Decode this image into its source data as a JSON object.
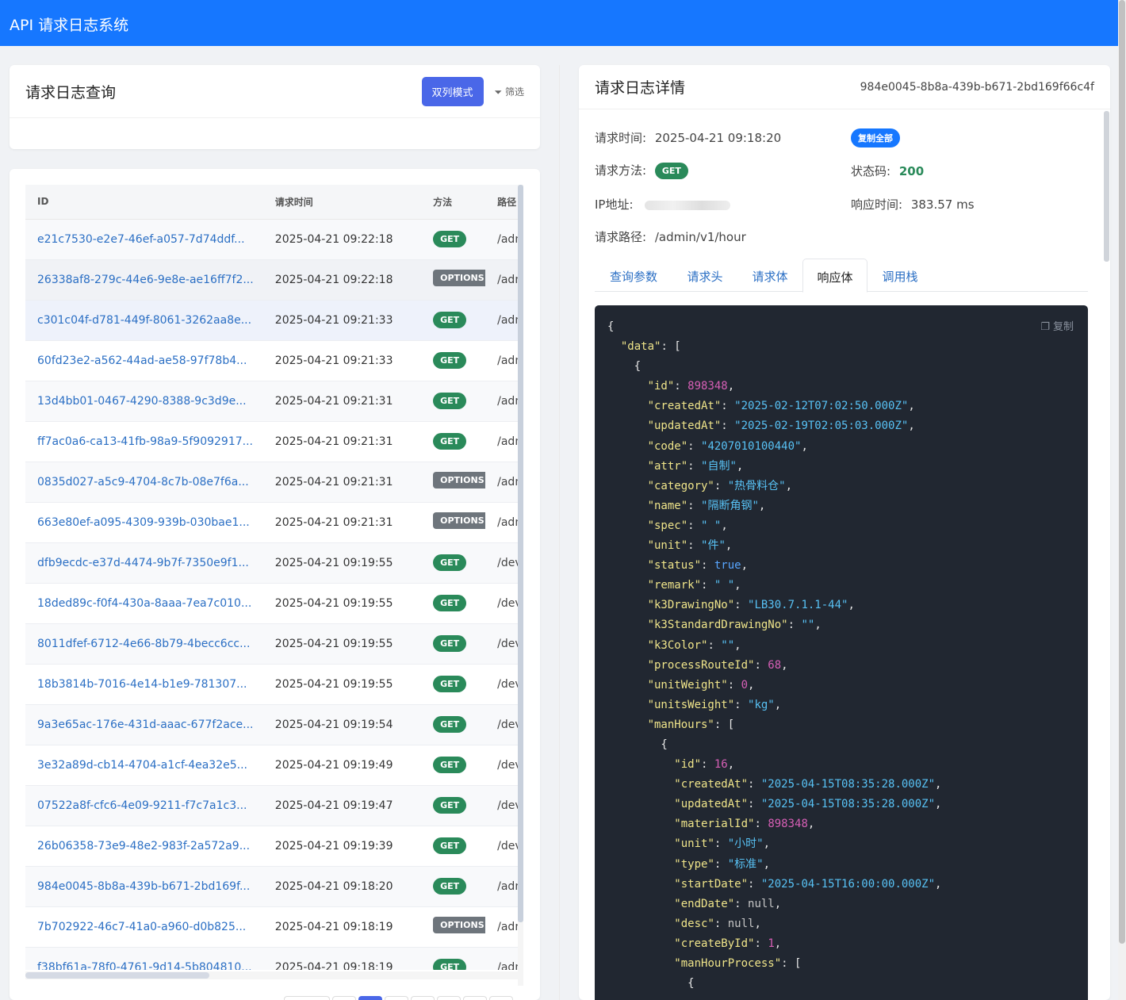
{
  "app": {
    "title": "API 请求日志系统"
  },
  "query": {
    "title": "请求日志查询",
    "dual_mode_label": "双列模式",
    "filter_label": "筛选"
  },
  "table": {
    "columns": [
      "ID",
      "请求时间",
      "方法",
      "路径"
    ],
    "rows": [
      {
        "id": "e21c7530-e2e7-46ef-a057-7d74ddf...",
        "time": "2025-04-21 09:22:18",
        "method": "GET",
        "path": "/adm"
      },
      {
        "id": "26338af8-279c-44e6-9e8e-ae16ff7f2...",
        "time": "2025-04-21 09:22:18",
        "method": "OPTIONS",
        "path": "/adm"
      },
      {
        "id": "c301c04f-d781-449f-8061-3262aa8e...",
        "time": "2025-04-21 09:21:33",
        "method": "GET",
        "path": "/adm"
      },
      {
        "id": "60fd23e2-a562-44ad-ae58-97f78b4...",
        "time": "2025-04-21 09:21:33",
        "method": "GET",
        "path": "/adm"
      },
      {
        "id": "13d4bb01-0467-4290-8388-9c3d9e...",
        "time": "2025-04-21 09:21:31",
        "method": "GET",
        "path": "/adm"
      },
      {
        "id": "ff7ac0a6-ca13-41fb-98a9-5f9092917...",
        "time": "2025-04-21 09:21:31",
        "method": "GET",
        "path": "/adm"
      },
      {
        "id": "0835d027-a5c9-4704-8c7b-08e7f6a...",
        "time": "2025-04-21 09:21:31",
        "method": "OPTIONS",
        "path": "/adm"
      },
      {
        "id": "663e80ef-a095-4309-939b-030bae1...",
        "time": "2025-04-21 09:21:31",
        "method": "OPTIONS",
        "path": "/adm"
      },
      {
        "id": "dfb9ecdc-e37d-4474-9b7f-7350e9f1...",
        "time": "2025-04-21 09:19:55",
        "method": "GET",
        "path": "/dev"
      },
      {
        "id": "18ded89c-f0f4-430a-8aaa-7ea7c010...",
        "time": "2025-04-21 09:19:55",
        "method": "GET",
        "path": "/dev"
      },
      {
        "id": "8011dfef-6712-4e66-8b79-4becc6cc...",
        "time": "2025-04-21 09:19:55",
        "method": "GET",
        "path": "/dev"
      },
      {
        "id": "18b3814b-7016-4e14-b1e9-781307...",
        "time": "2025-04-21 09:19:55",
        "method": "GET",
        "path": "/dev"
      },
      {
        "id": "9a3e65ac-176e-431d-aaac-677f2ace...",
        "time": "2025-04-21 09:19:54",
        "method": "GET",
        "path": "/dev"
      },
      {
        "id": "3e32a89d-cb14-4704-a1cf-4ea32e5...",
        "time": "2025-04-21 09:19:49",
        "method": "GET",
        "path": "/dev"
      },
      {
        "id": "07522a8f-cfc6-4e09-9211-f7c7a1c3...",
        "time": "2025-04-21 09:19:47",
        "method": "GET",
        "path": "/dev"
      },
      {
        "id": "26b06358-73e9-48e2-983f-2a572a9...",
        "time": "2025-04-21 09:19:39",
        "method": "GET",
        "path": "/dev"
      },
      {
        "id": "984e0045-8b8a-439b-b671-2bd169f...",
        "time": "2025-04-21 09:18:20",
        "method": "GET",
        "path": "/adm"
      },
      {
        "id": "7b702922-46c7-41a0-a960-d0b825...",
        "time": "2025-04-21 09:18:19",
        "method": "OPTIONS",
        "path": "/adm"
      },
      {
        "id": "f38bf61a-78f0-4761-9d14-5b804810...",
        "time": "2025-04-21 09:18:19",
        "method": "GET",
        "path": "/adm"
      }
    ]
  },
  "detail": {
    "title": "请求日志详情",
    "request_id": "984e0045-8b8a-439b-b671-2bd169f66c4f",
    "time_label": "请求时间:",
    "time_value": "2025-04-21 09:18:20",
    "copy_all_label": "复制全部",
    "method_label": "请求方法:",
    "method_value": "GET",
    "status_label": "状态码:",
    "status_value": "200",
    "ip_label": "IP地址:",
    "resp_time_label": "响应时间:",
    "resp_time_value": "383.57 ms",
    "path_label": "请求路径:",
    "path_value": "/admin/v1/hour",
    "tabs": [
      "查询参数",
      "请求头",
      "请求体",
      "响应体",
      "调用栈"
    ],
    "active_tab": "响应体",
    "copy_label": "复制",
    "json_lines": [
      [
        [
          "p",
          "{"
        ]
      ],
      [
        [
          "p",
          "  "
        ],
        [
          "k",
          "\"data\""
        ],
        [
          "p",
          ": ["
        ]
      ],
      [
        [
          "p",
          "    {"
        ]
      ],
      [
        [
          "p",
          "      "
        ],
        [
          "k",
          "\"id\""
        ],
        [
          "p",
          ": "
        ],
        [
          "n",
          "898348"
        ],
        [
          "p",
          ","
        ]
      ],
      [
        [
          "p",
          "      "
        ],
        [
          "k",
          "\"createdAt\""
        ],
        [
          "p",
          ": "
        ],
        [
          "s",
          "\"2025-02-12T07:02:50.000Z\""
        ],
        [
          "p",
          ","
        ]
      ],
      [
        [
          "p",
          "      "
        ],
        [
          "k",
          "\"updatedAt\""
        ],
        [
          "p",
          ": "
        ],
        [
          "s",
          "\"2025-02-19T02:05:03.000Z\""
        ],
        [
          "p",
          ","
        ]
      ],
      [
        [
          "p",
          "      "
        ],
        [
          "k",
          "\"code\""
        ],
        [
          "p",
          ": "
        ],
        [
          "s",
          "\"4207010100440\""
        ],
        [
          "p",
          ","
        ]
      ],
      [
        [
          "p",
          "      "
        ],
        [
          "k",
          "\"attr\""
        ],
        [
          "p",
          ": "
        ],
        [
          "s",
          "\"自制\""
        ],
        [
          "p",
          ","
        ]
      ],
      [
        [
          "p",
          "      "
        ],
        [
          "k",
          "\"category\""
        ],
        [
          "p",
          ": "
        ],
        [
          "s",
          "\"热骨料仓\""
        ],
        [
          "p",
          ","
        ]
      ],
      [
        [
          "p",
          "      "
        ],
        [
          "k",
          "\"name\""
        ],
        [
          "p",
          ": "
        ],
        [
          "s",
          "\"隔断角钢\""
        ],
        [
          "p",
          ","
        ]
      ],
      [
        [
          "p",
          "      "
        ],
        [
          "k",
          "\"spec\""
        ],
        [
          "p",
          ": "
        ],
        [
          "s",
          "\" \""
        ],
        [
          "p",
          ","
        ]
      ],
      [
        [
          "p",
          "      "
        ],
        [
          "k",
          "\"unit\""
        ],
        [
          "p",
          ": "
        ],
        [
          "s",
          "\"件\""
        ],
        [
          "p",
          ","
        ]
      ],
      [
        [
          "p",
          "      "
        ],
        [
          "k",
          "\"status\""
        ],
        [
          "p",
          ": "
        ],
        [
          "b",
          "true"
        ],
        [
          "p",
          ","
        ]
      ],
      [
        [
          "p",
          "      "
        ],
        [
          "k",
          "\"remark\""
        ],
        [
          "p",
          ": "
        ],
        [
          "s",
          "\" \""
        ],
        [
          "p",
          ","
        ]
      ],
      [
        [
          "p",
          "      "
        ],
        [
          "k",
          "\"k3DrawingNo\""
        ],
        [
          "p",
          ": "
        ],
        [
          "s",
          "\"LB30.7.1.1-44\""
        ],
        [
          "p",
          ","
        ]
      ],
      [
        [
          "p",
          "      "
        ],
        [
          "k",
          "\"k3StandardDrawingNo\""
        ],
        [
          "p",
          ": "
        ],
        [
          "s",
          "\"\""
        ],
        [
          "p",
          ","
        ]
      ],
      [
        [
          "p",
          "      "
        ],
        [
          "k",
          "\"k3Color\""
        ],
        [
          "p",
          ": "
        ],
        [
          "s",
          "\"\""
        ],
        [
          "p",
          ","
        ]
      ],
      [
        [
          "p",
          "      "
        ],
        [
          "k",
          "\"processRouteId\""
        ],
        [
          "p",
          ": "
        ],
        [
          "n",
          "68"
        ],
        [
          "p",
          ","
        ]
      ],
      [
        [
          "p",
          "      "
        ],
        [
          "k",
          "\"unitWeight\""
        ],
        [
          "p",
          ": "
        ],
        [
          "n",
          "0"
        ],
        [
          "p",
          ","
        ]
      ],
      [
        [
          "p",
          "      "
        ],
        [
          "k",
          "\"unitsWeight\""
        ],
        [
          "p",
          ": "
        ],
        [
          "s",
          "\"kg\""
        ],
        [
          "p",
          ","
        ]
      ],
      [
        [
          "p",
          "      "
        ],
        [
          "k",
          "\"manHours\""
        ],
        [
          "p",
          ": ["
        ]
      ],
      [
        [
          "p",
          "        {"
        ]
      ],
      [
        [
          "p",
          "          "
        ],
        [
          "k",
          "\"id\""
        ],
        [
          "p",
          ": "
        ],
        [
          "n",
          "16"
        ],
        [
          "p",
          ","
        ]
      ],
      [
        [
          "p",
          "          "
        ],
        [
          "k",
          "\"createdAt\""
        ],
        [
          "p",
          ": "
        ],
        [
          "s",
          "\"2025-04-15T08:35:28.000Z\""
        ],
        [
          "p",
          ","
        ]
      ],
      [
        [
          "p",
          "          "
        ],
        [
          "k",
          "\"updatedAt\""
        ],
        [
          "p",
          ": "
        ],
        [
          "s",
          "\"2025-04-15T08:35:28.000Z\""
        ],
        [
          "p",
          ","
        ]
      ],
      [
        [
          "p",
          "          "
        ],
        [
          "k",
          "\"materialId\""
        ],
        [
          "p",
          ": "
        ],
        [
          "n",
          "898348"
        ],
        [
          "p",
          ","
        ]
      ],
      [
        [
          "p",
          "          "
        ],
        [
          "k",
          "\"unit\""
        ],
        [
          "p",
          ": "
        ],
        [
          "s",
          "\"小时\""
        ],
        [
          "p",
          ","
        ]
      ],
      [
        [
          "p",
          "          "
        ],
        [
          "k",
          "\"type\""
        ],
        [
          "p",
          ": "
        ],
        [
          "s",
          "\"标准\""
        ],
        [
          "p",
          ","
        ]
      ],
      [
        [
          "p",
          "          "
        ],
        [
          "k",
          "\"startDate\""
        ],
        [
          "p",
          ": "
        ],
        [
          "s",
          "\"2025-04-15T16:00:00.000Z\""
        ],
        [
          "p",
          ","
        ]
      ],
      [
        [
          "p",
          "          "
        ],
        [
          "k",
          "\"endDate\""
        ],
        [
          "p",
          ": "
        ],
        [
          "nl",
          "null"
        ],
        [
          "p",
          ","
        ]
      ],
      [
        [
          "p",
          "          "
        ],
        [
          "k",
          "\"desc\""
        ],
        [
          "p",
          ": "
        ],
        [
          "nl",
          "null"
        ],
        [
          "p",
          ","
        ]
      ],
      [
        [
          "p",
          "          "
        ],
        [
          "k",
          "\"createById\""
        ],
        [
          "p",
          ": "
        ],
        [
          "n",
          "1"
        ],
        [
          "p",
          ","
        ]
      ],
      [
        [
          "p",
          "          "
        ],
        [
          "k",
          "\"manHourProcess\""
        ],
        [
          "p",
          ": ["
        ]
      ],
      [
        [
          "p",
          "            {"
        ]
      ]
    ]
  }
}
